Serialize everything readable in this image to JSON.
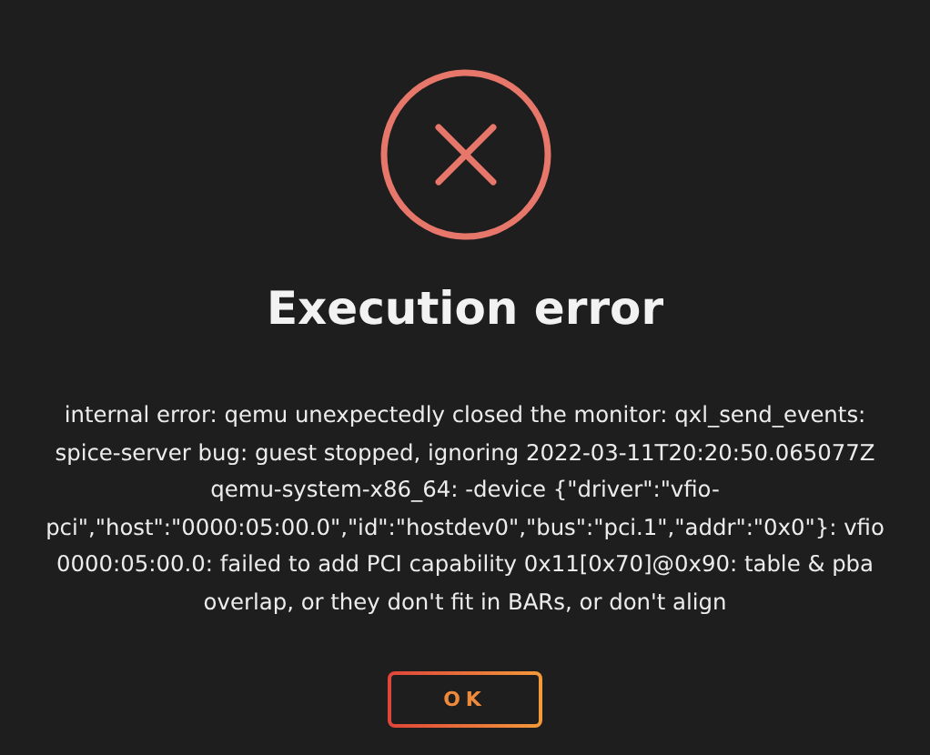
{
  "dialog": {
    "title": "Execution error",
    "message": "internal error: qemu unexpectedly closed the monitor: qxl_send_events: spice-server bug: guest stopped, ignoring 2022-03-11T20:20:50.065077Z qemu-system-x86_64: -device {\"driver\":\"vfio-pci\",\"host\":\"0000:05:00.0\",\"id\":\"hostdev0\",\"bus\":\"pci.1\",\"addr\":\"0x0\"}: vfio 0000:05:00.0: failed to add PCI capability 0x11[0x70]@0x90: table & pba overlap, or they don't fit in BARs, or don't align",
    "buttons": [
      "OK"
    ]
  }
}
